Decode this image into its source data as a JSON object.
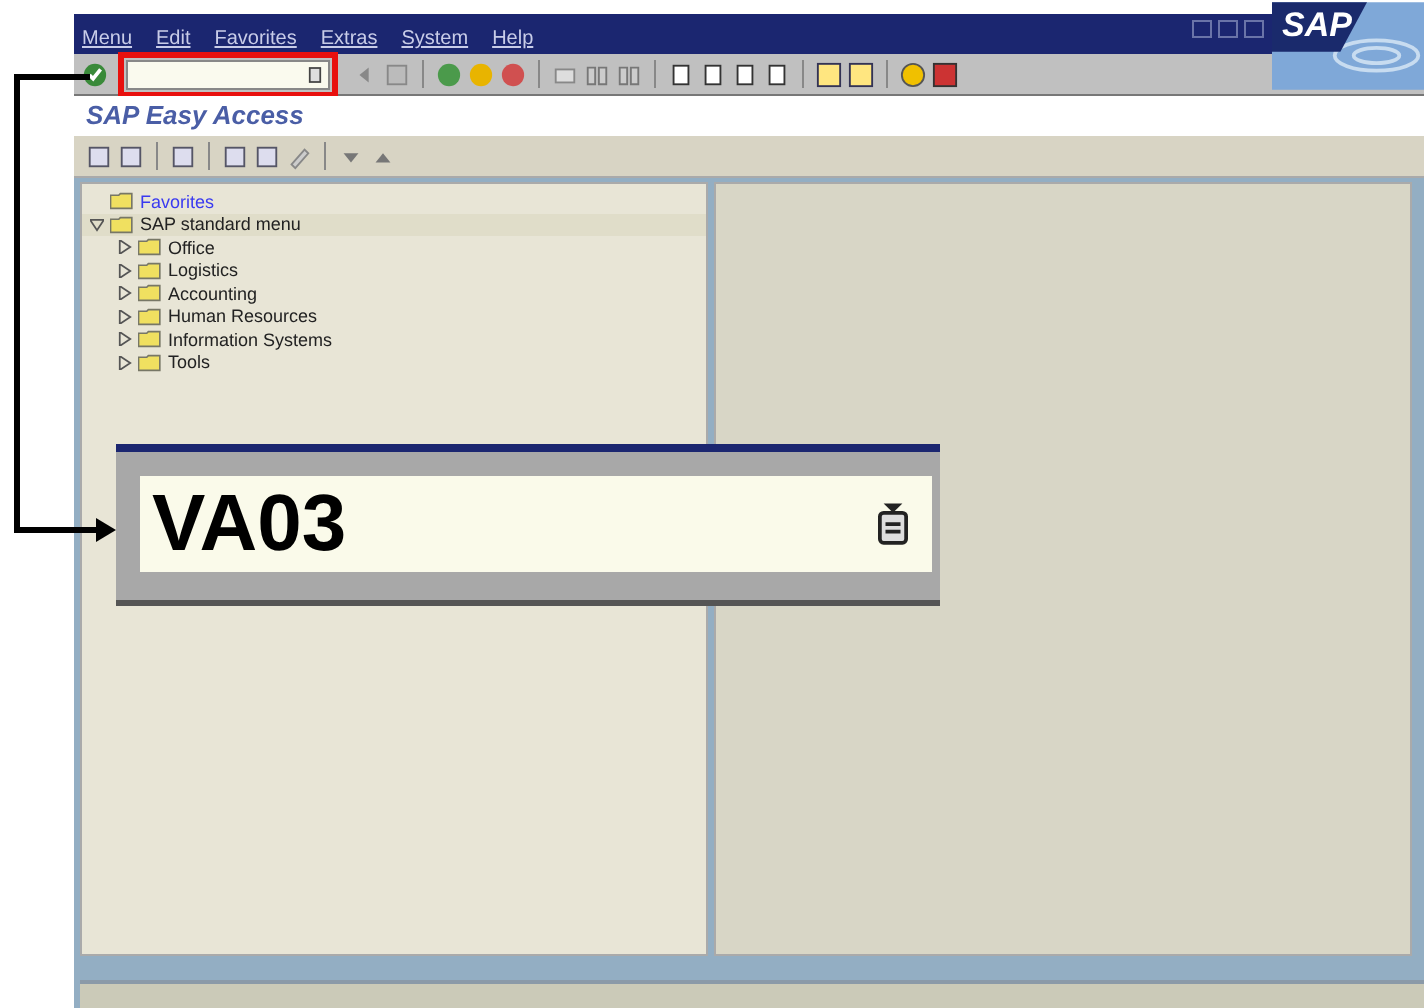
{
  "menu_bar": {
    "items": [
      "Menu",
      "Edit",
      "Favorites",
      "Extras",
      "System",
      "Help"
    ]
  },
  "logo": "SAP",
  "screen_title": "SAP Easy Access",
  "tree": [
    {
      "label": "Favorites",
      "kind": "favorites"
    },
    {
      "label": "SAP standard menu",
      "kind": "folder",
      "expanded": true,
      "children": [
        {
          "label": "Office",
          "kind": "folder",
          "expanded": false
        },
        {
          "label": "Logistics",
          "kind": "folder",
          "expanded": false
        },
        {
          "label": "Accounting",
          "kind": "folder",
          "expanded": false
        },
        {
          "label": "Human Resources",
          "kind": "folder",
          "expanded": false
        },
        {
          "label": "Information Systems",
          "kind": "folder",
          "expanded": false
        },
        {
          "label": "Tools",
          "kind": "folder",
          "expanded": false
        }
      ]
    }
  ],
  "callout": {
    "value": "VA03"
  }
}
